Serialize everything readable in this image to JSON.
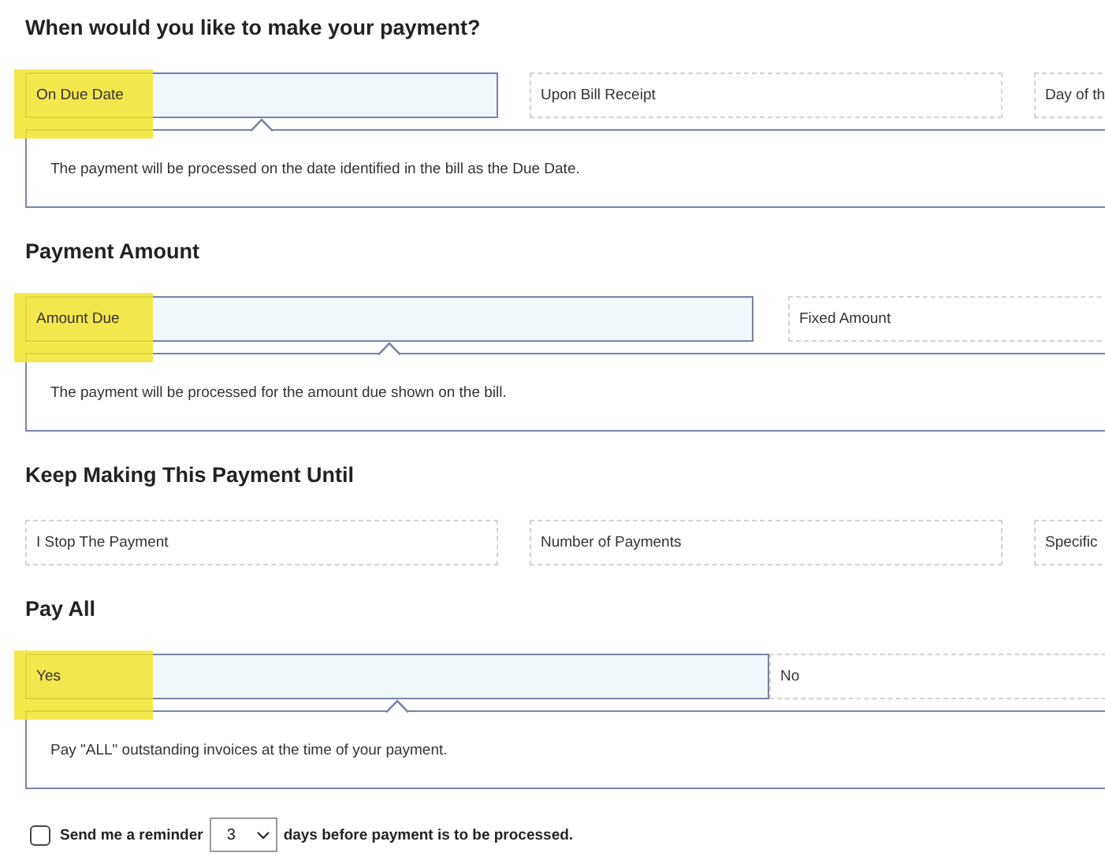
{
  "sections": [
    {
      "title": "When would you like to make your payment?",
      "options": [
        {
          "label": "On Due Date",
          "selected": true,
          "highlighted": true
        },
        {
          "label": "Upon Bill Receipt",
          "selected": false,
          "highlighted": false
        },
        {
          "label": "Day of th",
          "selected": false,
          "highlighted": false
        }
      ],
      "description": "The payment will be processed on the date identified in the bill as the Due Date."
    },
    {
      "title": "Payment Amount",
      "options": [
        {
          "label": "Amount Due",
          "selected": true,
          "highlighted": true
        },
        {
          "label": "Fixed Amount",
          "selected": false,
          "highlighted": false
        }
      ],
      "description": "The payment will be processed for the amount due shown on the bill."
    },
    {
      "title": "Keep Making This Payment Until",
      "options": [
        {
          "label": "I Stop The Payment",
          "selected": false,
          "highlighted": false
        },
        {
          "label": "Number of Payments",
          "selected": false,
          "highlighted": false
        },
        {
          "label": "Specific",
          "selected": false,
          "highlighted": false
        }
      ]
    },
    {
      "title": "Pay All",
      "options": [
        {
          "label": "Yes",
          "selected": true,
          "highlighted": true
        },
        {
          "label": "No",
          "selected": false,
          "highlighted": false
        }
      ],
      "description": "Pay \"ALL\" outstanding invoices at the time of your payment."
    }
  ],
  "reminder": {
    "checked": false,
    "label": "Send me a reminder",
    "days": "3",
    "suffix": "days before payment is to be processed."
  }
}
